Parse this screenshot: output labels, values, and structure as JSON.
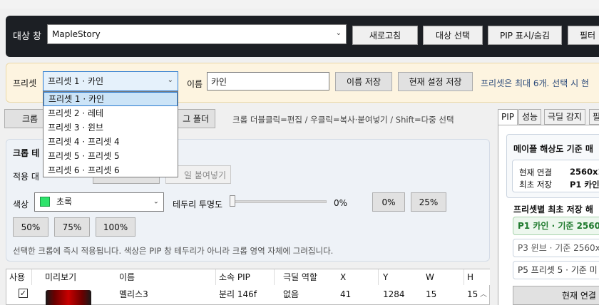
{
  "target": {
    "label": "대상 창",
    "window_value": "MapleStory",
    "buttons": [
      "새로고침",
      "대상 선택",
      "PIP 표시/숨김",
      "필터"
    ]
  },
  "preset": {
    "label": "프리셋",
    "selected": "프리셋 1 · 카인",
    "name_label": "이름",
    "name_value": "카인",
    "save_name": "이름 저장",
    "save_current": "현재 설정 저장",
    "note": "프리셋은 최대 6개. 선택 시 현",
    "options": [
      "프리셋 1 · 카인",
      "프리셋 2 · 레테",
      "프리셋 3 · 윈브",
      "프리셋 4 · 프리셋 4",
      "프리셋 5 · 프리셋 5",
      "프리셋 6 · 프리셋 6"
    ]
  },
  "crop_toolbar": {
    "crop_button": "크롭",
    "folder_button": "그 폴더",
    "help": "크롭 더블클릭=편집 / 우클릭=복사·붙여넣기 / Shift=다중 선택"
  },
  "crop_settings": {
    "title": "크롭 테",
    "apply_label": "적용 대",
    "paste_style": "일 붙여넣기",
    "color_label": "색상",
    "color_value": "초록",
    "border_label": "테두리 투명도",
    "opacity_value": "0%",
    "opacity_buttons": [
      "0%",
      "25%",
      "50%",
      "75%",
      "100%"
    ],
    "note": "선택한 크롭에 즉시 적용됩니다. 색상은 PIP 창 테두리가 아니라 크롭 영역 자체에 그려집니다.",
    "swatch_color": "#2ee36b"
  },
  "table": {
    "headers": [
      "사용",
      "미리보기",
      "이름",
      "소속 PIP",
      "극딜 역할",
      "X",
      "Y",
      "W",
      "H"
    ],
    "rows": [
      {
        "checked": "✓",
        "name": "멜리스3",
        "pip": "분리 146f",
        "role": "없음",
        "x": "41",
        "y": "1284",
        "w": "15",
        "h": "15"
      }
    ]
  },
  "right": {
    "tabs": [
      "PIP",
      "성능",
      "극딜 감지",
      "필"
    ],
    "header": "메이플 해상도 기준 매",
    "conn_label": "현재 연결",
    "conn_value": "2560x1",
    "first_label": "최초 저장",
    "first_value": "P1 카인",
    "per_preset_title": "프리셋별 최초 저장 해",
    "items": [
      "P1 카인 · 기준 2560x",
      "P3 윈브 · 기준 2560x",
      "P5 프리셋 5 · 기준 미"
    ],
    "bottom_button": "현재 연결"
  }
}
